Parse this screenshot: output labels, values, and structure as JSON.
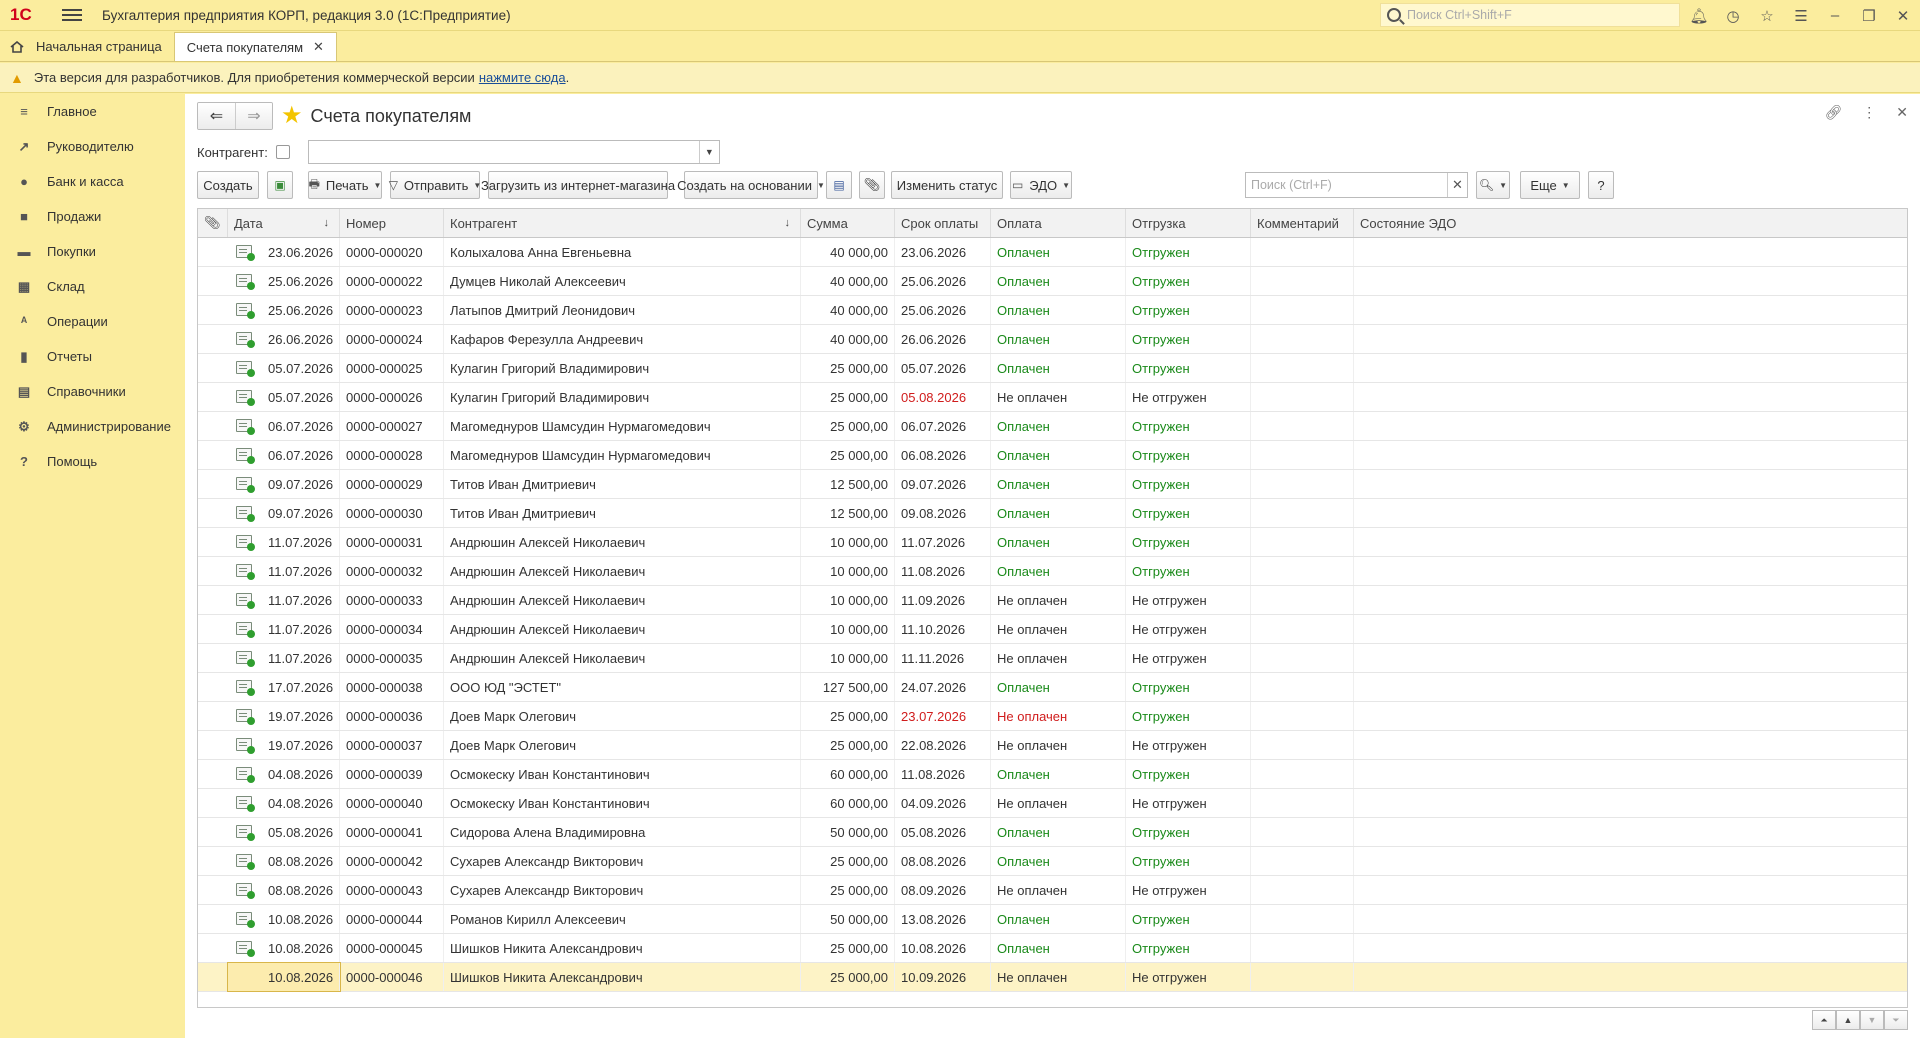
{
  "app": {
    "logo": "1С",
    "title": "Бухгалтерия предприятия КОРП, редакция 3.0  (1С:Предприятие)",
    "search_placeholder": "Поиск Ctrl+Shift+F"
  },
  "tabs": [
    {
      "label": "Начальная страница"
    },
    {
      "label": "Счета покупателям"
    }
  ],
  "warning": {
    "text": "Эта версия для разработчиков. Для приобретения коммерческой версии",
    "link": "нажмите сюда",
    "suffix": "."
  },
  "sidebar": {
    "items": [
      {
        "label": "Главное",
        "icon": "menu-icon"
      },
      {
        "label": "Руководителю",
        "icon": "trend-icon"
      },
      {
        "label": "Банк и касса",
        "icon": "coin-icon"
      },
      {
        "label": "Продажи",
        "icon": "bag-icon"
      },
      {
        "label": "Покупки",
        "icon": "cart-icon"
      },
      {
        "label": "Склад",
        "icon": "warehouse-icon"
      },
      {
        "label": "Операции",
        "icon": "operations-icon"
      },
      {
        "label": "Отчеты",
        "icon": "chart-icon"
      },
      {
        "label": "Справочники",
        "icon": "book-icon"
      },
      {
        "label": "Администрирование",
        "icon": "gear-icon"
      },
      {
        "label": "Помощь",
        "icon": "help-icon"
      }
    ]
  },
  "page": {
    "title": "Счета покупателям",
    "filter_label": "Контрагент:",
    "filter_value": ""
  },
  "toolbar": {
    "create": "Создать",
    "print": "Печать",
    "send": "Отправить",
    "load": "Загрузить из интернет-магазина",
    "create_based": "Создать на основании",
    "change_status": "Изменить статус",
    "edo": "ЭДО",
    "search_placeholder": "Поиск (Ctrl+F)",
    "more": "Еще",
    "help": "?"
  },
  "table": {
    "columns": [
      "Дата",
      "Номер",
      "Контрагент",
      "Сумма",
      "Срок оплаты",
      "Оплата",
      "Отгрузка",
      "Комментарий",
      "Состояние ЭДО"
    ],
    "rows": [
      {
        "date": "23.06.2026",
        "number": "0000-000020",
        "contractor": "Колыхалова Анна Евгеньевна",
        "sum": "40 000,00",
        "due": "23.06.2026",
        "paid": "Оплачен",
        "shipped": "Отгружен"
      },
      {
        "date": "25.06.2026",
        "number": "0000-000022",
        "contractor": "Думцев Николай Алексеевич",
        "sum": "40 000,00",
        "due": "25.06.2026",
        "paid": "Оплачен",
        "shipped": "Отгружен"
      },
      {
        "date": "25.06.2026",
        "number": "0000-000023",
        "contractor": "Латыпов Дмитрий Леонидович",
        "sum": "40 000,00",
        "due": "25.06.2026",
        "paid": "Оплачен",
        "shipped": "Отгружен"
      },
      {
        "date": "26.06.2026",
        "number": "0000-000024",
        "contractor": "Кафаров Ферезулла Андреевич",
        "sum": "40 000,00",
        "due": "26.06.2026",
        "paid": "Оплачен",
        "shipped": "Отгружен"
      },
      {
        "date": "05.07.2026",
        "number": "0000-000025",
        "contractor": "Кулагин Григорий Владимирович",
        "sum": "25 000,00",
        "due": "05.07.2026",
        "paid": "Оплачен",
        "shipped": "Отгружен"
      },
      {
        "date": "05.07.2026",
        "number": "0000-000026",
        "contractor": "Кулагин Григорий Владимирович",
        "sum": "25 000,00",
        "due": "05.08.2026",
        "paid": "Не оплачен",
        "shipped": "Не отгружен",
        "due_overdue": true
      },
      {
        "date": "06.07.2026",
        "number": "0000-000027",
        "contractor": "Магомеднуров Шамсудин Нурмагомедович",
        "sum": "25 000,00",
        "due": "06.07.2026",
        "paid": "Оплачен",
        "shipped": "Отгружен"
      },
      {
        "date": "06.07.2026",
        "number": "0000-000028",
        "contractor": "Магомеднуров Шамсудин Нурмагомедович",
        "sum": "25 000,00",
        "due": "06.08.2026",
        "paid": "Оплачен",
        "shipped": "Отгружен"
      },
      {
        "date": "09.07.2026",
        "number": "0000-000029",
        "contractor": "Титов Иван Дмитриевич",
        "sum": "12 500,00",
        "due": "09.07.2026",
        "paid": "Оплачен",
        "shipped": "Отгружен"
      },
      {
        "date": "09.07.2026",
        "number": "0000-000030",
        "contractor": "Титов Иван Дмитриевич",
        "sum": "12 500,00",
        "due": "09.08.2026",
        "paid": "Оплачен",
        "shipped": "Отгружен"
      },
      {
        "date": "11.07.2026",
        "number": "0000-000031",
        "contractor": "Андрюшин Алексей Николаевич",
        "sum": "10 000,00",
        "due": "11.07.2026",
        "paid": "Оплачен",
        "shipped": "Отгружен"
      },
      {
        "date": "11.07.2026",
        "number": "0000-000032",
        "contractor": "Андрюшин Алексей Николаевич",
        "sum": "10 000,00",
        "due": "11.08.2026",
        "paid": "Оплачен",
        "shipped": "Отгружен"
      },
      {
        "date": "11.07.2026",
        "number": "0000-000033",
        "contractor": "Андрюшин Алексей Николаевич",
        "sum": "10 000,00",
        "due": "11.09.2026",
        "paid": "Не оплачен",
        "shipped": "Не отгружен"
      },
      {
        "date": "11.07.2026",
        "number": "0000-000034",
        "contractor": "Андрюшин Алексей Николаевич",
        "sum": "10 000,00",
        "due": "11.10.2026",
        "paid": "Не оплачен",
        "shipped": "Не отгружен"
      },
      {
        "date": "11.07.2026",
        "number": "0000-000035",
        "contractor": "Андрюшин Алексей Николаевич",
        "sum": "10 000,00",
        "due": "11.11.2026",
        "paid": "Не оплачен",
        "shipped": "Не отгружен"
      },
      {
        "date": "17.07.2026",
        "number": "0000-000038",
        "contractor": "ООО ЮД \"ЭСТЕТ\"",
        "sum": "127 500,00",
        "due": "24.07.2026",
        "paid": "Оплачен",
        "shipped": "Отгружен"
      },
      {
        "date": "19.07.2026",
        "number": "0000-000036",
        "contractor": "Доев Марк Олегович",
        "sum": "25 000,00",
        "due": "23.07.2026",
        "paid": "Не оплачен",
        "shipped": "Отгружен",
        "due_overdue": true,
        "paid_overdue": true
      },
      {
        "date": "19.07.2026",
        "number": "0000-000037",
        "contractor": "Доев Марк Олегович",
        "sum": "25 000,00",
        "due": "22.08.2026",
        "paid": "Не оплачен",
        "shipped": "Не отгружен"
      },
      {
        "date": "04.08.2026",
        "number": "0000-000039",
        "contractor": "Осмокеску Иван Константинович",
        "sum": "60 000,00",
        "due": "11.08.2026",
        "paid": "Оплачен",
        "shipped": "Отгружен"
      },
      {
        "date": "04.08.2026",
        "number": "0000-000040",
        "contractor": "Осмокеску Иван Константинович",
        "sum": "60 000,00",
        "due": "04.09.2026",
        "paid": "Не оплачен",
        "shipped": "Не отгружен"
      },
      {
        "date": "05.08.2026",
        "number": "0000-000041",
        "contractor": "Сидорова Алена Владимировна",
        "sum": "50 000,00",
        "due": "05.08.2026",
        "paid": "Оплачен",
        "shipped": "Отгружен"
      },
      {
        "date": "08.08.2026",
        "number": "0000-000042",
        "contractor": "Сухарев Александр Викторович",
        "sum": "25 000,00",
        "due": "08.08.2026",
        "paid": "Оплачен",
        "shipped": "Отгружен"
      },
      {
        "date": "08.08.2026",
        "number": "0000-000043",
        "contractor": "Сухарев Александр Викторович",
        "sum": "25 000,00",
        "due": "08.09.2026",
        "paid": "Не оплачен",
        "shipped": "Не отгружен"
      },
      {
        "date": "10.08.2026",
        "number": "0000-000044",
        "contractor": "Романов Кирилл Алексеевич",
        "sum": "50 000,00",
        "due": "13.08.2026",
        "paid": "Оплачен",
        "shipped": "Отгружен"
      },
      {
        "date": "10.08.2026",
        "number": "0000-000045",
        "contractor": "Шишков Никита Александрович",
        "sum": "25 000,00",
        "due": "10.08.2026",
        "paid": "Оплачен",
        "shipped": "Отгружен"
      },
      {
        "date": "10.08.2026",
        "number": "0000-000046",
        "contractor": "Шишков Никита Александрович",
        "sum": "25 000,00",
        "due": "10.09.2026",
        "paid": "Не оплачен",
        "shipped": "Не отгружен",
        "selected": true
      }
    ]
  },
  "colors": {
    "accent_yellow": "#fbed9e",
    "paid_green": "#1a8a1a",
    "overdue_red": "#d01c1c",
    "link_blue": "#1a4e99"
  }
}
